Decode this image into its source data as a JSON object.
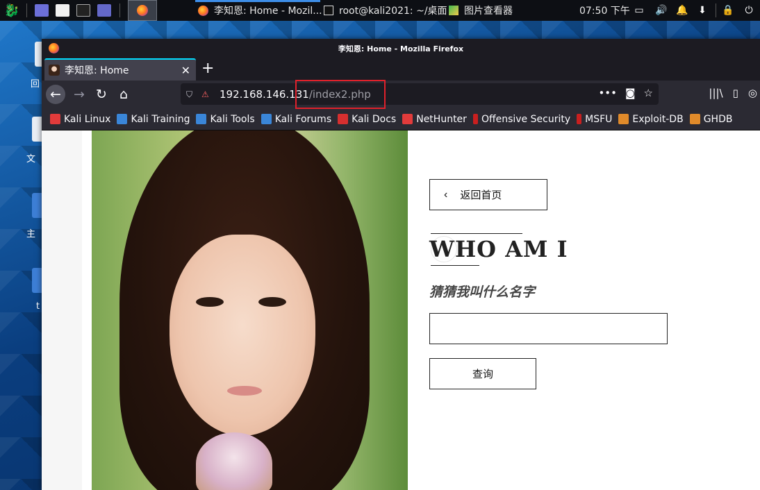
{
  "panel": {
    "tasks": [
      {
        "title": "李知恩: Home - Mozil...",
        "icon": "firefox-icon"
      },
      {
        "title": "root@kali2021: ~/桌面",
        "icon": "terminal-icon"
      },
      {
        "title": "图片查看器",
        "icon": "image-viewer-icon"
      }
    ],
    "clock": "07:50 下午"
  },
  "desktop": {
    "labels": [
      "回",
      "文",
      "主",
      "t"
    ]
  },
  "window": {
    "title": "李知恩: Home - Mozilla Firefox"
  },
  "tab": {
    "label": "李知恩: Home",
    "close_glyph": "✕",
    "new_tab_glyph": "+"
  },
  "navbar": {
    "url_host": "192.168.146.131",
    "url_path": "/index2.php"
  },
  "bookmarks": [
    {
      "label": "Kali Linux",
      "icon": "kali-icon",
      "color": "#e23b3b"
    },
    {
      "label": "Kali Training",
      "icon": "kali-training-icon",
      "color": "#3a86d8"
    },
    {
      "label": "Kali Tools",
      "icon": "kali-tools-icon",
      "color": "#3a86d8"
    },
    {
      "label": "Kali Forums",
      "icon": "kali-forums-icon",
      "color": "#3a86d8"
    },
    {
      "label": "Kali Docs",
      "icon": "kali-docs-icon",
      "color": "#d62f2f"
    },
    {
      "label": "NetHunter",
      "icon": "nethunter-icon",
      "color": "#e23b3b"
    },
    {
      "label": "Offensive Security",
      "icon": "offsec-icon",
      "color": "#c91f1f"
    },
    {
      "label": "MSFU",
      "icon": "msfu-icon",
      "color": "#c91f1f"
    },
    {
      "label": "Exploit-DB",
      "icon": "exploit-db-icon",
      "color": "#e08a2a"
    },
    {
      "label": "GHDB",
      "icon": "ghdb-icon",
      "color": "#e08a2a"
    }
  ],
  "page": {
    "back_label": "返回首页",
    "heading": "WHO AM I",
    "subheading": "猜猜我叫什么名字",
    "input_value": "",
    "query_label": "查询"
  },
  "colors": {
    "firefox_dark": "#1c1b22",
    "toolbar": "#2b2a33",
    "tab_accent": "#00ddff",
    "highlight_box": "#e1212b"
  }
}
